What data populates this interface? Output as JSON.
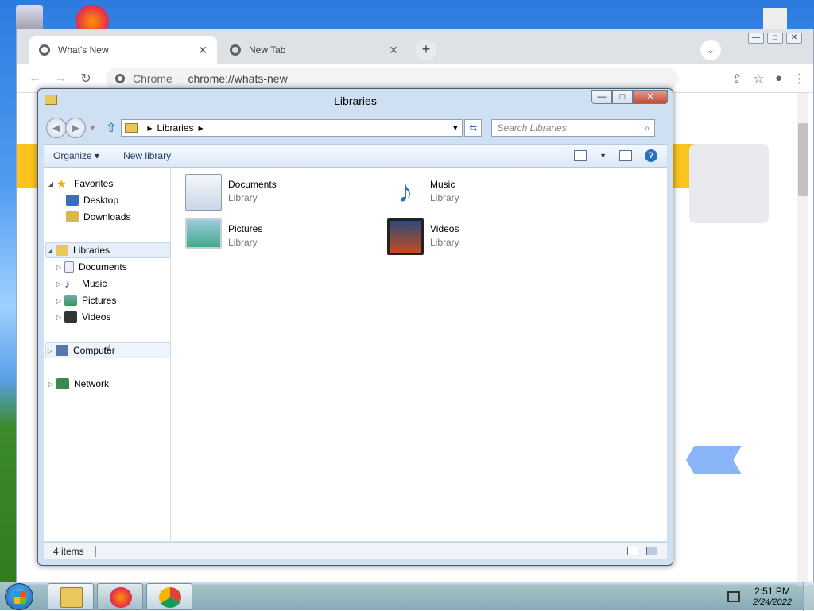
{
  "desktop": {
    "icons": [
      "recycle-bin-icon",
      "firefox-icon",
      "file-icon"
    ]
  },
  "chrome": {
    "tabs": [
      {
        "label": "What's New",
        "active": true
      },
      {
        "label": "New Tab",
        "active": false
      }
    ],
    "tab_close": "✕",
    "new_tab": "+",
    "tab_search": "⌄",
    "window_controls": {
      "minimize": "—",
      "maximize": "□",
      "close": "✕"
    },
    "omnibox": {
      "site": "Chrome",
      "url": "chrome://whats-new"
    },
    "icons": {
      "back": "←",
      "forward": "→",
      "reload": "↻",
      "share": "⇪",
      "bookmark": "☆",
      "profile": "●",
      "menu": "⋮"
    }
  },
  "explorer": {
    "title": "Libraries",
    "controls": {
      "minimize": "—",
      "maximize": "□",
      "close": "✕"
    },
    "address": {
      "crumb": "Libraries"
    },
    "search_placeholder": "Search Libraries",
    "command_bar": {
      "organize": "Organize ▾",
      "new_library": "New library"
    },
    "nav": {
      "favorites": "Favorites",
      "desktop": "Desktop",
      "downloads": "Downloads",
      "libraries": "Libraries",
      "documents": "Documents",
      "music": "Music",
      "pictures": "Pictures",
      "videos": "Videos",
      "computer": "Computer",
      "network": "Network"
    },
    "libraries": [
      {
        "name": "Documents",
        "type": "Library"
      },
      {
        "name": "Music",
        "type": "Library"
      },
      {
        "name": "Pictures",
        "type": "Library"
      },
      {
        "name": "Videos",
        "type": "Library"
      }
    ],
    "status": {
      "count": "4 items"
    }
  },
  "taskbar": {
    "apps": [
      "windows-explorer",
      "firefox",
      "chrome"
    ],
    "clock": {
      "time": "2:51 PM",
      "date": "2/24/2022"
    }
  },
  "colors": {
    "chrome_tabstrip": "#dee1e6",
    "explorer_frame": "#cfe0f2",
    "selection": "#e5eef9",
    "yellow_banner": "#fbbc04"
  }
}
